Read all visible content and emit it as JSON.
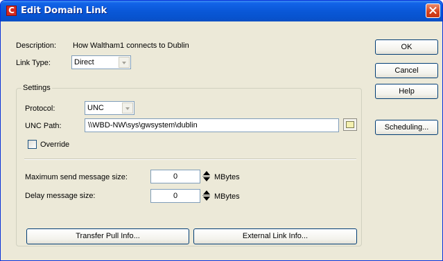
{
  "window": {
    "title": "Edit Domain Link",
    "icon_letter": "C"
  },
  "description": {
    "label": "Description:",
    "value": "How Waltham1 connects to Dublin"
  },
  "link_type": {
    "label": "Link Type:",
    "value": "Direct"
  },
  "settings": {
    "legend": "Settings",
    "protocol": {
      "label": "Protocol:",
      "value": "UNC"
    },
    "unc_path": {
      "label": "UNC Path:",
      "value": "\\\\WBD-NW\\sys\\gwsystem\\dublin"
    },
    "override": {
      "label": "Override",
      "checked": false
    },
    "max_send": {
      "label": "Maximum send message size:",
      "value": "0",
      "unit": "MBytes"
    },
    "delay": {
      "label": "Delay message size:",
      "value": "0",
      "unit": "MBytes"
    },
    "transfer_pull_button": "Transfer Pull Info...",
    "external_link_button": "External Link Info..."
  },
  "buttons": {
    "ok": "OK",
    "cancel": "Cancel",
    "help": "Help",
    "scheduling": "Scheduling..."
  },
  "colors": {
    "title_bar": "#0a58d8",
    "dialog_face": "#ece9d8",
    "close_button": "#d5401b"
  }
}
